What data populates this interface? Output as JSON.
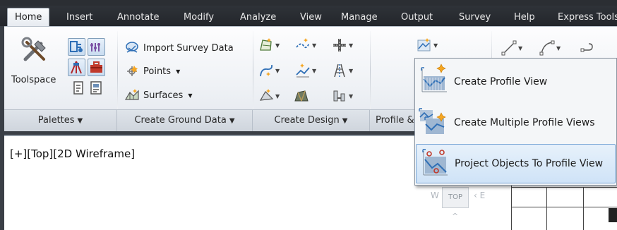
{
  "tabs": [
    {
      "label": "Home",
      "active": true
    },
    {
      "label": "Insert"
    },
    {
      "label": "Annotate"
    },
    {
      "label": "Modify"
    },
    {
      "label": "Analyze"
    },
    {
      "label": "View"
    },
    {
      "label": "Manage"
    },
    {
      "label": "Output"
    },
    {
      "label": "Survey"
    },
    {
      "label": "Help"
    },
    {
      "label": "Express Tools"
    }
  ],
  "ribbon": {
    "toolspace_label": "Toolspace",
    "import_survey_label": "Import Survey Data",
    "points_label": "Points",
    "surfaces_label": "Surfaces",
    "panels": [
      {
        "label": "Palettes"
      },
      {
        "label": "Create Ground Data"
      },
      {
        "label": "Create Design"
      },
      {
        "label": "Profile & Section Views"
      }
    ]
  },
  "drawing": {
    "viewport_label": "[+][Top][2D Wireframe]",
    "viewcube": {
      "top_label": "TOP",
      "west_label": "W",
      "east_label": "E"
    }
  },
  "profile_menu": {
    "items": [
      {
        "label": "Create Profile View"
      },
      {
        "label": "Create Multiple Profile Views"
      },
      {
        "label": "Project Objects To Profile View",
        "highlighted": true
      }
    ]
  },
  "colors": {
    "accent": "#2f6fb6",
    "highlight": "#cfe3f7",
    "ribbon_bg": "#eef1f5",
    "tabbar_bg": "#2b2e33"
  }
}
